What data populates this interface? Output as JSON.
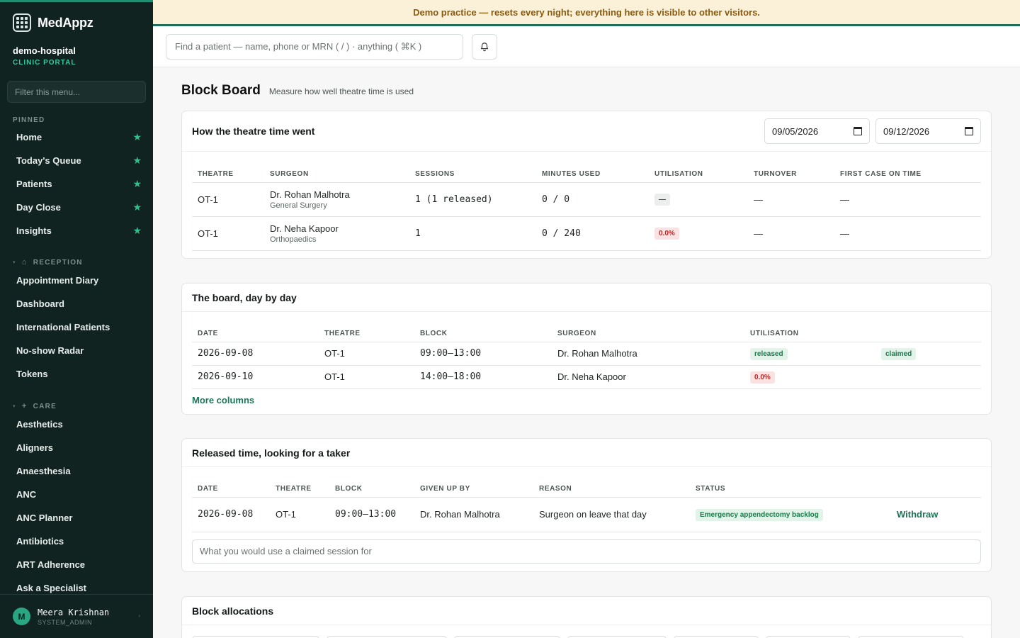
{
  "brand": {
    "name": "MedAppz"
  },
  "org": {
    "name": "demo-hospital",
    "portal": "CLINIC PORTAL"
  },
  "sidebar": {
    "filter_placeholder": "Filter this menu...",
    "pinned_label": "PINNED",
    "pinned": [
      {
        "label": "Home"
      },
      {
        "label": "Today's Queue"
      },
      {
        "label": "Patients"
      },
      {
        "label": "Day Close"
      },
      {
        "label": "Insights"
      }
    ],
    "reception_label": "RECEPTION",
    "reception": [
      {
        "label": "Appointment Diary"
      },
      {
        "label": "Dashboard"
      },
      {
        "label": "International Patients"
      },
      {
        "label": "No-show Radar"
      },
      {
        "label": "Tokens"
      }
    ],
    "care_label": "CARE",
    "care": [
      {
        "label": "Aesthetics"
      },
      {
        "label": "Aligners"
      },
      {
        "label": "Anaesthesia"
      },
      {
        "label": "ANC"
      },
      {
        "label": "ANC Planner"
      },
      {
        "label": "Antibiotics"
      },
      {
        "label": "ART Adherence"
      },
      {
        "label": "Ask a Specialist"
      }
    ]
  },
  "user": {
    "initial": "M",
    "name": "Meera Krishnan",
    "role": "SYSTEM_ADMIN"
  },
  "banner": {
    "text": "Demo practice — resets every night; everything here is visible to other visitors."
  },
  "topbar": {
    "search_placeholder": "Find a patient — name, phone or MRN ( / ) · anything ( ⌘K )"
  },
  "page": {
    "title": "Block Board",
    "subtitle": "Measure how well theatre time is used"
  },
  "theatre_time": {
    "title": "How the theatre time went",
    "from_date": "09/05/2026",
    "to_date": "09/12/2026",
    "columns": [
      "THEATRE",
      "SURGEON",
      "SESSIONS",
      "MINUTES USED",
      "UTILISATION",
      "TURNOVER",
      "FIRST CASE ON TIME"
    ],
    "rows": [
      {
        "theatre": "OT-1",
        "surgeon": "Dr. Rohan Malhotra",
        "specialty": "General Surgery",
        "sessions": "1 (1 released)",
        "minutes": "0 / 0",
        "utilisation": "—",
        "turnover": "—",
        "first_case": "—"
      },
      {
        "theatre": "OT-1",
        "surgeon": "Dr. Neha Kapoor",
        "specialty": "Orthopaedics",
        "sessions": "1",
        "minutes": "0 / 240",
        "utilisation": "0.0%",
        "turnover": "—",
        "first_case": "—"
      }
    ]
  },
  "day_board": {
    "title": "The board, day by day",
    "columns": [
      "DATE",
      "THEATRE",
      "BLOCK",
      "SURGEON",
      "UTILISATION"
    ],
    "rows": [
      {
        "date": "2026-09-08",
        "theatre": "OT-1",
        "block": "09:00–13:00",
        "surgeon": "Dr. Rohan Malhotra",
        "utilisation": "released",
        "extra": "claimed"
      },
      {
        "date": "2026-09-10",
        "theatre": "OT-1",
        "block": "14:00–18:00",
        "surgeon": "Dr. Neha Kapoor",
        "utilisation": "0.0%",
        "extra": ""
      }
    ],
    "more_columns": "More columns"
  },
  "released_time": {
    "title": "Released time, looking for a taker",
    "columns": [
      "DATE",
      "THEATRE",
      "BLOCK",
      "GIVEN UP BY",
      "REASON",
      "STATUS"
    ],
    "rows": [
      {
        "date": "2026-09-08",
        "theatre": "OT-1",
        "block": "09:00–13:00",
        "given_up_by": "Dr. Rohan Malhotra",
        "reason": "Surgeon on leave that day",
        "status": "Emergency appendectomy backlog",
        "action": "Withdraw"
      }
    ],
    "claim_placeholder": "What you would use a claimed session for"
  },
  "allocations": {
    "title": "Block allocations"
  },
  "colors": {
    "accent": "#1f8f71",
    "sidebar_bg": "#112321",
    "banner_bg": "#fbf1d8",
    "banner_text": "#8a5a0e"
  },
  "icons": {
    "logo": "grid-logo-icon",
    "star": "star-icon",
    "bell": "bell-icon",
    "calendar": "calendar-icon",
    "home": "home-icon",
    "plus": "plus-icon"
  }
}
